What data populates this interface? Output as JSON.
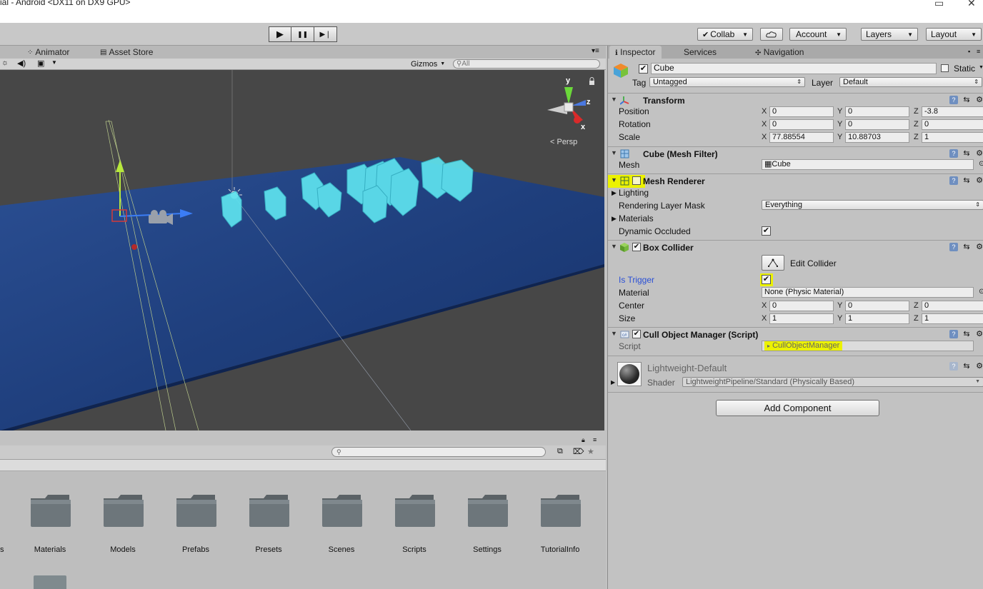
{
  "titlebar": {
    "title": "ial - Android <DX11 on DX9 GPU>",
    "restore_glyph": "▭",
    "close_glyph": "✕"
  },
  "toolbar": {
    "play_glyph": "▶",
    "pause_glyph": "❚❚",
    "step_glyph": "▶❘",
    "collab_label": "Collab",
    "account_label": "Account",
    "layers_label": "Layers",
    "layout_label": "Layout"
  },
  "scene": {
    "tabs": [
      "Animator",
      "Asset Store"
    ],
    "gizmos_label": "Gizmos",
    "search_placeholder": "All",
    "persp_label": "< Persp",
    "gizmo_axes": {
      "y": "y",
      "z": "z",
      "x": "x"
    }
  },
  "project": {
    "folders": [
      "Materials",
      "Models",
      "Prefabs",
      "Presets",
      "Scenes",
      "Scripts",
      "Settings",
      "TutorialInfo"
    ],
    "cut_label": "s"
  },
  "inspector": {
    "tabs": [
      "Inspector",
      "Services",
      "Navigation"
    ],
    "object_name": "Cube",
    "static_label": "Static",
    "tag_label": "Tag",
    "tag_value": "Untagged",
    "layer_label": "Layer",
    "layer_value": "Default",
    "transform": {
      "title": "Transform",
      "position_label": "Position",
      "position": [
        "0",
        "0",
        "-3.8"
      ],
      "rotation_label": "Rotation",
      "rotation": [
        "0",
        "0",
        "0"
      ],
      "scale_label": "Scale",
      "scale": [
        "77.88554",
        "10.88703",
        "1"
      ]
    },
    "mesh_filter": {
      "title": "Cube (Mesh Filter)",
      "mesh_label": "Mesh",
      "mesh_value": "Cube"
    },
    "mesh_renderer": {
      "title": "Mesh Renderer",
      "lighting_label": "Lighting",
      "layer_mask_label": "Rendering Layer Mask",
      "layer_mask_value": "Everything",
      "materials_label": "Materials",
      "dynamic_occluded_label": "Dynamic Occluded"
    },
    "box_collider": {
      "title": "Box Collider",
      "edit_collider_label": "Edit Collider",
      "is_trigger_label": "Is Trigger",
      "material_label": "Material",
      "material_value": "None (Physic Material)",
      "center_label": "Center",
      "center": [
        "0",
        "0",
        "0"
      ],
      "size_label": "Size",
      "size": [
        "1",
        "1",
        "1"
      ]
    },
    "cull_script": {
      "title": "Cull Object Manager (Script)",
      "script_label": "Script",
      "script_value": "CullObjectManager"
    },
    "material": {
      "name": "Lightweight-Default",
      "shader_label": "Shader",
      "shader_value": "LightweightPipeline/Standard (Physically Based)"
    },
    "add_component_label": "Add Component",
    "axis_x": "X",
    "axis_y": "Y",
    "axis_z": "Z"
  },
  "colors": {
    "highlight": "#ecf200",
    "water": "#1f3f7d",
    "cubes": "#5ee3ef"
  }
}
